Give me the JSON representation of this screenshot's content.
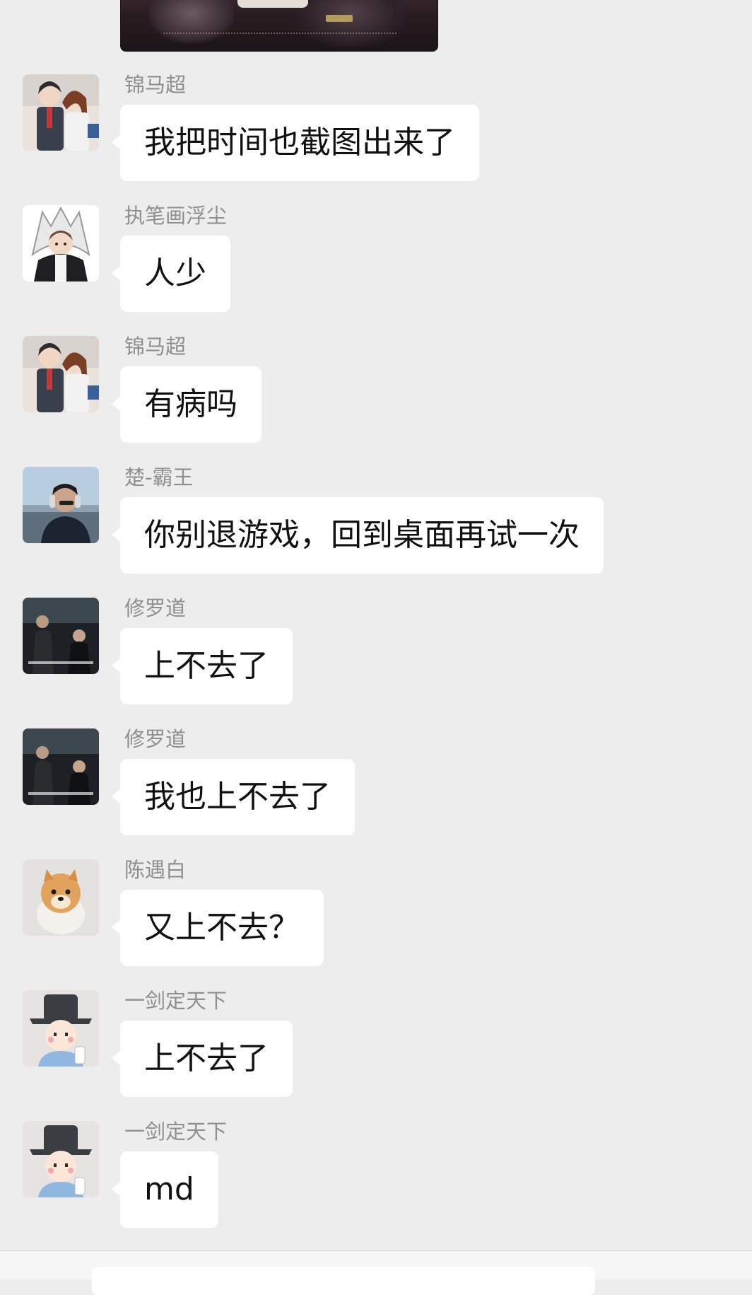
{
  "chat": {
    "image_message": {
      "sender": "",
      "kind": "game-screenshot"
    },
    "messages": [
      {
        "sender": "锦马超",
        "text": "我把时间也截图出来了",
        "avatar": "anime-couple-avatar"
      },
      {
        "sender": "执笔画浮尘",
        "text": "人少",
        "avatar": "white-wolf-hood-avatar"
      },
      {
        "sender": "锦马超",
        "text": "有病吗",
        "avatar": "anime-couple-avatar"
      },
      {
        "sender": "楚-霸王",
        "text": "你别退游戏，回到桌面再试一次",
        "avatar": "headphones-man-avatar"
      },
      {
        "sender": "修罗道",
        "text": "上不去了",
        "avatar": "film-still-avatar"
      },
      {
        "sender": "修罗道",
        "text": "我也上不去了",
        "avatar": "film-still-avatar"
      },
      {
        "sender": "陈遇白",
        "text": "又上不去？",
        "avatar": "pomeranian-dog-avatar"
      },
      {
        "sender": "一剑定天下",
        "text": "上不去了",
        "avatar": "cartoon-hat-man-avatar"
      },
      {
        "sender": "一剑定天下",
        "text": "md",
        "avatar": "cartoon-hat-man-avatar"
      }
    ]
  },
  "colors": {
    "background": "#ededed",
    "bubble": "#ffffff",
    "sender_text": "#8f8f8f",
    "message_text": "#111111"
  }
}
